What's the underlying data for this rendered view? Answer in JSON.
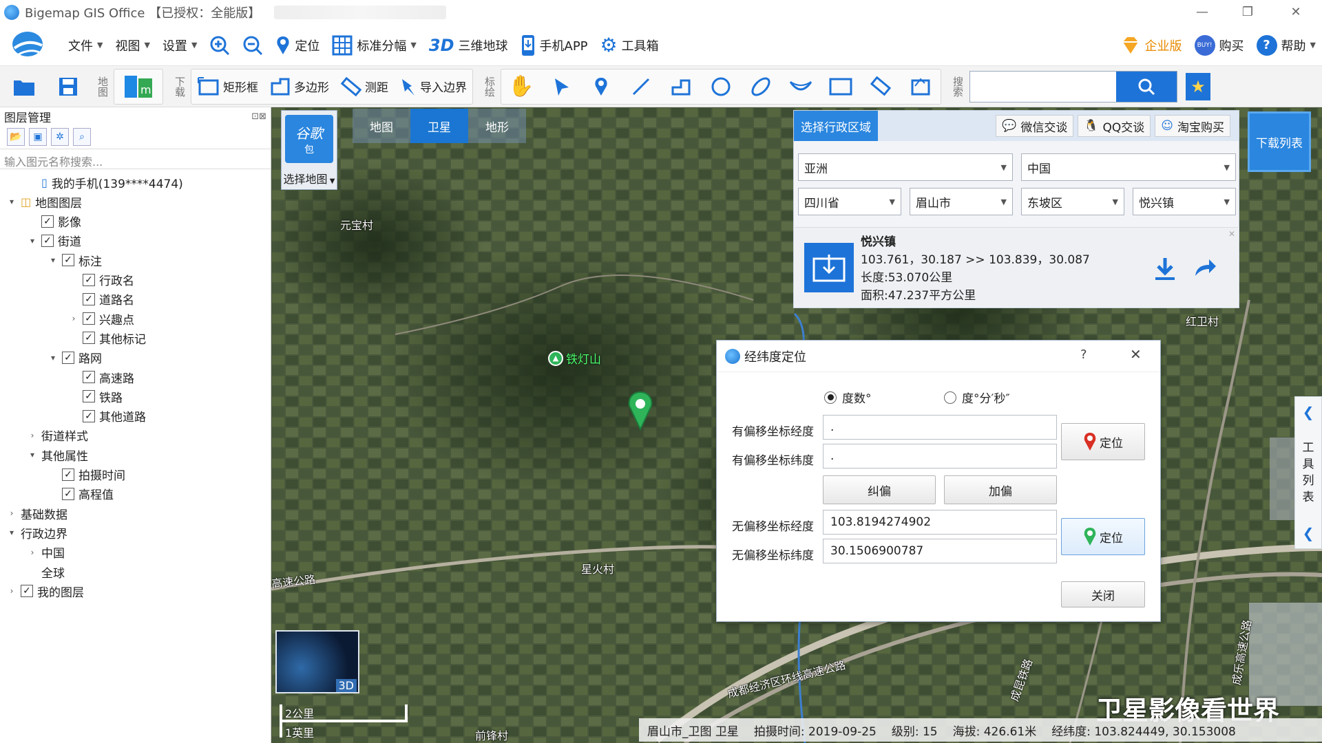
{
  "app": {
    "title": "Bigemap GIS Office 【已授权：全能版】",
    "window_controls": {
      "minimize": "—",
      "restore": "❐",
      "close": "✕"
    }
  },
  "menu": {
    "file": "文件",
    "view": "视图",
    "settings": "设置",
    "locate": "定位",
    "grid": "标准分幅",
    "globe_3d": "三维地球",
    "globe_3d_icon": "3D",
    "mobile_app": "手机APP",
    "toolbox": "工具箱",
    "enterprise": "企业版",
    "buy": "购买",
    "buy_icon": "BUY!",
    "help": "帮助"
  },
  "toolbar": {
    "map_group": "地图",
    "download_group": "下载",
    "rect": "矩形框",
    "polygon": "多边形",
    "measure": "测距",
    "import_boundary": "导入边界",
    "draw_group": "标绘",
    "search_group": "搜索",
    "search_placeholder": ""
  },
  "layer_panel": {
    "title": "图层管理",
    "search_placeholder": "输入图元名称搜索...",
    "tree": [
      {
        "label": "我的手机(139****4474)",
        "level": 1,
        "twisty": "",
        "check": "none"
      },
      {
        "label": "地图图层",
        "level": 0,
        "twisty": "open",
        "check": "none"
      },
      {
        "label": "影像",
        "level": 1,
        "twisty": "",
        "check": "checked"
      },
      {
        "label": "街道",
        "level": 1,
        "twisty": "open",
        "check": "checked"
      },
      {
        "label": "标注",
        "level": 2,
        "twisty": "open",
        "check": "checked"
      },
      {
        "label": "行政名",
        "level": 3,
        "twisty": "",
        "check": "checked"
      },
      {
        "label": "道路名",
        "level": 3,
        "twisty": "",
        "check": "checked"
      },
      {
        "label": "兴趣点",
        "level": 3,
        "twisty": "closed",
        "check": "checked"
      },
      {
        "label": "其他标记",
        "level": 3,
        "twisty": "",
        "check": "checked"
      },
      {
        "label": "路网",
        "level": 2,
        "twisty": "open",
        "check": "checked"
      },
      {
        "label": "高速路",
        "level": 3,
        "twisty": "",
        "check": "checked"
      },
      {
        "label": "铁路",
        "level": 3,
        "twisty": "",
        "check": "checked"
      },
      {
        "label": "其他道路",
        "level": 3,
        "twisty": "",
        "check": "checked"
      },
      {
        "label": "街道样式",
        "level": 1,
        "twisty": "closed",
        "check": "none"
      },
      {
        "label": "其他属性",
        "level": 1,
        "twisty": "open",
        "check": "none"
      },
      {
        "label": "拍摄时间",
        "level": 2,
        "twisty": "",
        "check": "checked"
      },
      {
        "label": "高程值",
        "level": 2,
        "twisty": "",
        "check": "checked"
      },
      {
        "label": "基础数据",
        "level": 0,
        "twisty": "closed",
        "check": "none"
      },
      {
        "label": "行政边界",
        "level": 0,
        "twisty": "open",
        "check": "none"
      },
      {
        "label": "中国",
        "level": 1,
        "twisty": "closed",
        "check": "none"
      },
      {
        "label": "全球",
        "level": 1,
        "twisty": "",
        "check": "none"
      },
      {
        "label": "我的图层",
        "level": 0,
        "twisty": "closed",
        "check": "checked"
      }
    ]
  },
  "map": {
    "select_map": "选择地图",
    "logo_text": "谷歌",
    "logo_sub": "包",
    "types": [
      "地图",
      "卫星",
      "地形"
    ],
    "active_type": "卫星",
    "labels": {
      "yuanbao": "元宝村",
      "tiedengshan": "铁灯山",
      "xinghuo": "星火村",
      "highway": "高速公路",
      "hongwei": "红卫村",
      "ring": "成都经济区环线高速公路",
      "qianfeng": "前锋村",
      "railway": "成昆铁路",
      "shacheng": "成乐高速公路"
    },
    "scale": {
      "km": "2公里",
      "mi": "1英里"
    },
    "minimap_label": "3D",
    "watermark": "卫星影像看世界"
  },
  "region": {
    "title": "选择行政区域",
    "wechat": "微信交谈",
    "qq": "QQ交谈",
    "taobao": "淘宝购买",
    "continent": "亚洲",
    "country": "中国",
    "province": "四川省",
    "city": "眉山市",
    "district": "东坡区",
    "town": "悦兴镇",
    "download_list": "下载列表",
    "info": {
      "name": "悦兴镇",
      "coords": "103.761，30.187 >> 103.839，30.087",
      "length": "长度:53.070公里",
      "area": "面积:47.237平方公里"
    }
  },
  "dialog": {
    "title": "经纬度定位",
    "help": "?",
    "close_x": "✕",
    "radio_degree": "度数°",
    "radio_dms": "度°分′秒″",
    "offset_lng_label": "有偏移坐标经度",
    "offset_lat_label": "有偏移坐标纬度",
    "offset_lng": ".",
    "offset_lat": ".",
    "locate1": "定位",
    "correct": "纠偏",
    "add_offset": "加偏",
    "nooffset_lng_label": "无偏移坐标经度",
    "nooffset_lat_label": "无偏移坐标纬度",
    "nooffset_lng": "103.8194274902",
    "nooffset_lat": "30.1506900787",
    "locate2": "定位",
    "close": "关闭"
  },
  "status": {
    "source": "眉山市_卫图 卫星",
    "date": "拍摄时间: 2019-09-25",
    "level": "级别:  15",
    "elev": "海拔: 426.61米",
    "coords": "经纬度:  103.824449, 30.153008"
  },
  "side_tools": {
    "label": "工具列表"
  },
  "colors": {
    "accent": "#1a76d2",
    "pin": "#2fb45a",
    "region_header": "#2a86df"
  }
}
